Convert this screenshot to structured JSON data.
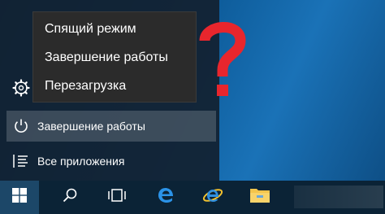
{
  "power_menu": {
    "items": [
      {
        "label": "Спящий режим"
      },
      {
        "label": "Завершение работы"
      },
      {
        "label": "Перезагрузка"
      }
    ]
  },
  "start_menu": {
    "power_label": "Завершение работы",
    "all_apps_label": "Все приложения"
  },
  "overlay": {
    "question_mark": "?",
    "question_color": "#e8262d"
  },
  "taskbar": {
    "icons": [
      "windows-logo-icon",
      "search-icon",
      "task-view-icon",
      "edge-icon",
      "internet-explorer-icon",
      "file-explorer-icon"
    ]
  }
}
